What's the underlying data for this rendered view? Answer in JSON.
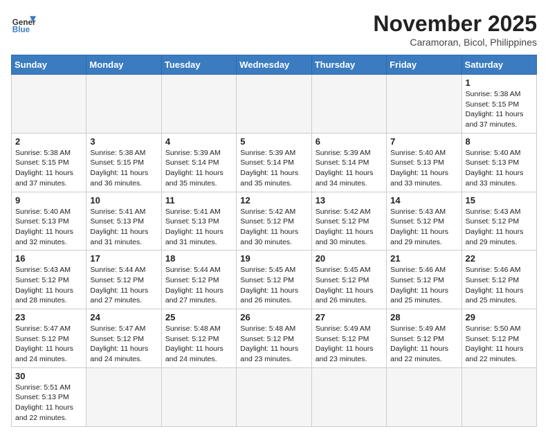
{
  "header": {
    "logo_general": "General",
    "logo_blue": "Blue",
    "month_title": "November 2025",
    "location": "Caramoran, Bicol, Philippines"
  },
  "weekdays": [
    "Sunday",
    "Monday",
    "Tuesday",
    "Wednesday",
    "Thursday",
    "Friday",
    "Saturday"
  ],
  "days": [
    {
      "num": "",
      "empty": true
    },
    {
      "num": "",
      "empty": true
    },
    {
      "num": "",
      "empty": true
    },
    {
      "num": "",
      "empty": true
    },
    {
      "num": "",
      "empty": true
    },
    {
      "num": "",
      "empty": true
    },
    {
      "num": "1",
      "sunrise": "5:38 AM",
      "sunset": "5:15 PM",
      "daylight": "11 hours and 37 minutes."
    },
    {
      "num": "2",
      "sunrise": "5:38 AM",
      "sunset": "5:15 PM",
      "daylight": "11 hours and 37 minutes."
    },
    {
      "num": "3",
      "sunrise": "5:38 AM",
      "sunset": "5:15 PM",
      "daylight": "11 hours and 36 minutes."
    },
    {
      "num": "4",
      "sunrise": "5:39 AM",
      "sunset": "5:14 PM",
      "daylight": "11 hours and 35 minutes."
    },
    {
      "num": "5",
      "sunrise": "5:39 AM",
      "sunset": "5:14 PM",
      "daylight": "11 hours and 35 minutes."
    },
    {
      "num": "6",
      "sunrise": "5:39 AM",
      "sunset": "5:14 PM",
      "daylight": "11 hours and 34 minutes."
    },
    {
      "num": "7",
      "sunrise": "5:40 AM",
      "sunset": "5:13 PM",
      "daylight": "11 hours and 33 minutes."
    },
    {
      "num": "8",
      "sunrise": "5:40 AM",
      "sunset": "5:13 PM",
      "daylight": "11 hours and 33 minutes."
    },
    {
      "num": "9",
      "sunrise": "5:40 AM",
      "sunset": "5:13 PM",
      "daylight": "11 hours and 32 minutes."
    },
    {
      "num": "10",
      "sunrise": "5:41 AM",
      "sunset": "5:13 PM",
      "daylight": "11 hours and 31 minutes."
    },
    {
      "num": "11",
      "sunrise": "5:41 AM",
      "sunset": "5:13 PM",
      "daylight": "11 hours and 31 minutes."
    },
    {
      "num": "12",
      "sunrise": "5:42 AM",
      "sunset": "5:12 PM",
      "daylight": "11 hours and 30 minutes."
    },
    {
      "num": "13",
      "sunrise": "5:42 AM",
      "sunset": "5:12 PM",
      "daylight": "11 hours and 30 minutes."
    },
    {
      "num": "14",
      "sunrise": "5:43 AM",
      "sunset": "5:12 PM",
      "daylight": "11 hours and 29 minutes."
    },
    {
      "num": "15",
      "sunrise": "5:43 AM",
      "sunset": "5:12 PM",
      "daylight": "11 hours and 29 minutes."
    },
    {
      "num": "16",
      "sunrise": "5:43 AM",
      "sunset": "5:12 PM",
      "daylight": "11 hours and 28 minutes."
    },
    {
      "num": "17",
      "sunrise": "5:44 AM",
      "sunset": "5:12 PM",
      "daylight": "11 hours and 27 minutes."
    },
    {
      "num": "18",
      "sunrise": "5:44 AM",
      "sunset": "5:12 PM",
      "daylight": "11 hours and 27 minutes."
    },
    {
      "num": "19",
      "sunrise": "5:45 AM",
      "sunset": "5:12 PM",
      "daylight": "11 hours and 26 minutes."
    },
    {
      "num": "20",
      "sunrise": "5:45 AM",
      "sunset": "5:12 PM",
      "daylight": "11 hours and 26 minutes."
    },
    {
      "num": "21",
      "sunrise": "5:46 AM",
      "sunset": "5:12 PM",
      "daylight": "11 hours and 25 minutes."
    },
    {
      "num": "22",
      "sunrise": "5:46 AM",
      "sunset": "5:12 PM",
      "daylight": "11 hours and 25 minutes."
    },
    {
      "num": "23",
      "sunrise": "5:47 AM",
      "sunset": "5:12 PM",
      "daylight": "11 hours and 24 minutes."
    },
    {
      "num": "24",
      "sunrise": "5:47 AM",
      "sunset": "5:12 PM",
      "daylight": "11 hours and 24 minutes."
    },
    {
      "num": "25",
      "sunrise": "5:48 AM",
      "sunset": "5:12 PM",
      "daylight": "11 hours and 24 minutes."
    },
    {
      "num": "26",
      "sunrise": "5:48 AM",
      "sunset": "5:12 PM",
      "daylight": "11 hours and 23 minutes."
    },
    {
      "num": "27",
      "sunrise": "5:49 AM",
      "sunset": "5:12 PM",
      "daylight": "11 hours and 23 minutes."
    },
    {
      "num": "28",
      "sunrise": "5:49 AM",
      "sunset": "5:12 PM",
      "daylight": "11 hours and 22 minutes."
    },
    {
      "num": "29",
      "sunrise": "5:50 AM",
      "sunset": "5:12 PM",
      "daylight": "11 hours and 22 minutes."
    },
    {
      "num": "30",
      "sunrise": "5:51 AM",
      "sunset": "5:13 PM",
      "daylight": "11 hours and 22 minutes."
    },
    {
      "num": "",
      "empty": true
    },
    {
      "num": "",
      "empty": true
    },
    {
      "num": "",
      "empty": true
    },
    {
      "num": "",
      "empty": true
    },
    {
      "num": "",
      "empty": true
    },
    {
      "num": "",
      "empty": true
    }
  ]
}
